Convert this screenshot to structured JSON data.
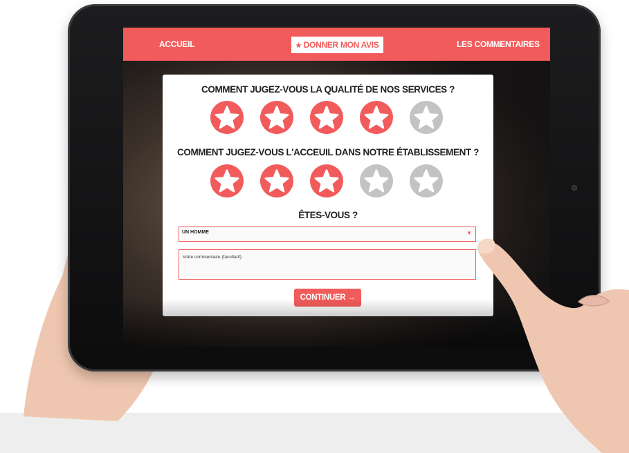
{
  "nav": {
    "accueil": "ACCUEIL",
    "donner_avis": "DONNER MON AVIS",
    "commentaires": "LES COMMENTAIRES"
  },
  "form": {
    "q1": "COMMENT JUGEZ-VOUS LA QUALITÉ DE NOS SERVICES ?",
    "q1_rating": 4,
    "q2": "COMMENT JUGEZ-VOUS L'ACCEUIL DANS NOTRE ÉTABLISSEMENT ?",
    "q2_rating": 3,
    "q3": "ÊTES-VOUS ?",
    "select_value": "UN HOMME",
    "comment_placeholder": "Votre commentaire  (facultatif)",
    "continue": "CONTINUER →",
    "max_stars": 5
  },
  "colors": {
    "accent": "#f25b5b",
    "star_inactive": "#c3c3c3",
    "card": "#ffffff"
  },
  "icons": {
    "star": "star-icon",
    "dropdown": "chevron-down-icon"
  }
}
